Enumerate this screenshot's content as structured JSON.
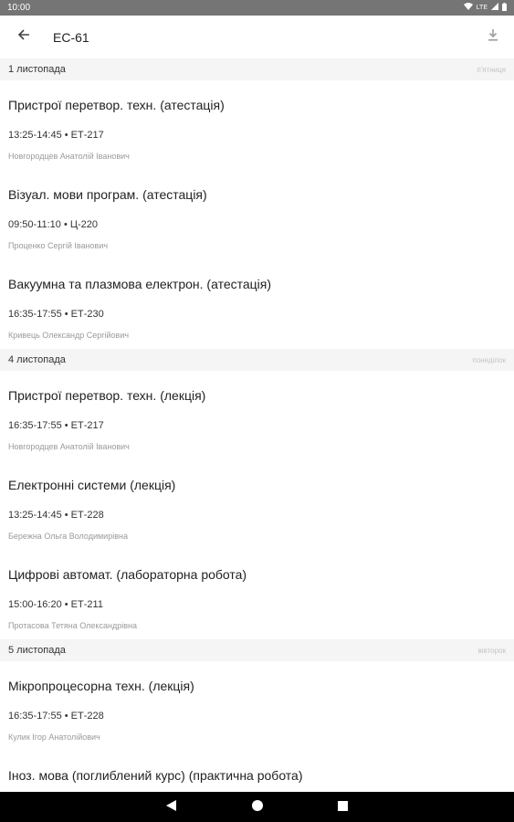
{
  "status_bar": {
    "time": "10:00",
    "network": "LTE",
    "icons": [
      "wifi-icon",
      "signal-icon",
      "battery-icon"
    ]
  },
  "app_bar": {
    "title": "ЕС-61",
    "icons": [
      "back-arrow-icon",
      "download-icon"
    ]
  },
  "days": [
    {
      "date": "1 листопада",
      "weekday": "п'ятниця",
      "lessons": [
        {
          "name": "Пристрої перетвор. техн. (атестація)",
          "time": "13:25-14:45 • ЕТ-217",
          "teacher": "Новгородцев Анатолій Іванович"
        },
        {
          "name": "Візуал. мови програм. (атестація)",
          "time": "09:50-11:10 • Ц-220",
          "teacher": "Проценко Сергій Іванович"
        },
        {
          "name": "Вакуумна та плазмова електрон. (атестація)",
          "time": "16:35-17:55 • ЕТ-230",
          "teacher": "Кривець Олександр Сергійович"
        }
      ]
    },
    {
      "date": "4 листопада",
      "weekday": "понеділок",
      "lessons": [
        {
          "name": "Пристрої перетвор. техн. (лекція)",
          "time": "16:35-17:55 • ЕТ-217",
          "teacher": "Новгородцев Анатолій Іванович"
        },
        {
          "name": "Електронні системи (лекція)",
          "time": "13:25-14:45 • ЕТ-228",
          "teacher": "Бережна Ольга Володимирівна"
        },
        {
          "name": "Цифрові автомат. (лабораторна робота)",
          "time": "15:00-16:20 • ЕТ-211",
          "teacher": "Протасова Тетяна Олександрівна"
        }
      ]
    },
    {
      "date": "5 листопада",
      "weekday": "вівторок",
      "lessons": [
        {
          "name": "Мікропроцесорна техн. (лекція)",
          "time": "16:35-17:55 • ЕТ-228",
          "teacher": "Кулик Ігор Анатолійович"
        },
        {
          "name": "Іноз. мова (поглиблений курс) (практична робота)",
          "time": "",
          "teacher": ""
        }
      ]
    }
  ],
  "nav_bar": {
    "icons": [
      "back-triangle-icon",
      "home-circle-icon",
      "recents-square-icon"
    ]
  }
}
